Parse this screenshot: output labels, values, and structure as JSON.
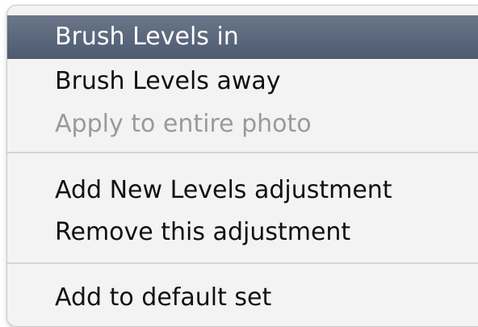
{
  "menu": {
    "items": [
      {
        "label": "Brush Levels in",
        "state": "highlighted"
      },
      {
        "label": "Brush Levels away",
        "state": "enabled"
      },
      {
        "label": "Apply to entire photo",
        "state": "disabled"
      },
      {
        "label": "Add New Levels adjustment",
        "state": "enabled"
      },
      {
        "label": "Remove this adjustment",
        "state": "enabled"
      },
      {
        "label": "Add to default set",
        "state": "enabled"
      }
    ],
    "colors": {
      "highlight_top": "#6a7689",
      "highlight_bottom": "#4e5a70",
      "disabled_text": "#9a9a9a",
      "background": "#f3f3f3"
    }
  }
}
